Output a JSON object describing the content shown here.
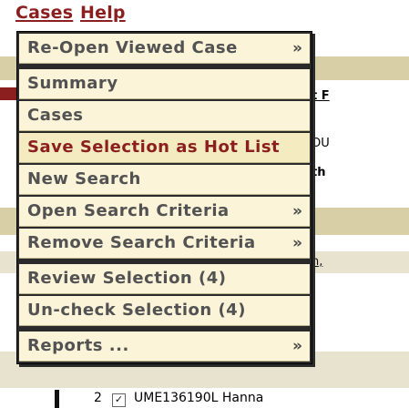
{
  "menubar": {
    "cases_label": "Cases",
    "help_label": "Help"
  },
  "background": {
    "fragment_1": "t F",
    "fragment_2": "OU",
    "fragment_3": "th",
    "fragment_4": "n,"
  },
  "menu": {
    "items": [
      {
        "label": "Re-Open Viewed Case",
        "arrow": "»"
      },
      {
        "label": "Summary"
      },
      {
        "label": "Cases"
      },
      {
        "label": "Save Selection as Hot List"
      },
      {
        "label": "New Search"
      },
      {
        "label": "Open Search Criteria",
        "arrow": "»"
      },
      {
        "label": "Remove Search Criteria",
        "arrow": "»"
      },
      {
        "label": "Review Selection (4)"
      },
      {
        "label": "Un-check Selection (4)"
      },
      {
        "label": "Reports ...",
        "arrow": "»"
      }
    ]
  },
  "table_row": {
    "number": "2",
    "checkbox_mark": "✓",
    "text": "UME136190L Hanna"
  },
  "colors": {
    "menu_label": "#525252",
    "highlight_label": "#8b1e1e",
    "menu_bg": "#fbf4d8",
    "highlight_bg": "#f4ecc0",
    "background_band": "#d8cfa6"
  }
}
